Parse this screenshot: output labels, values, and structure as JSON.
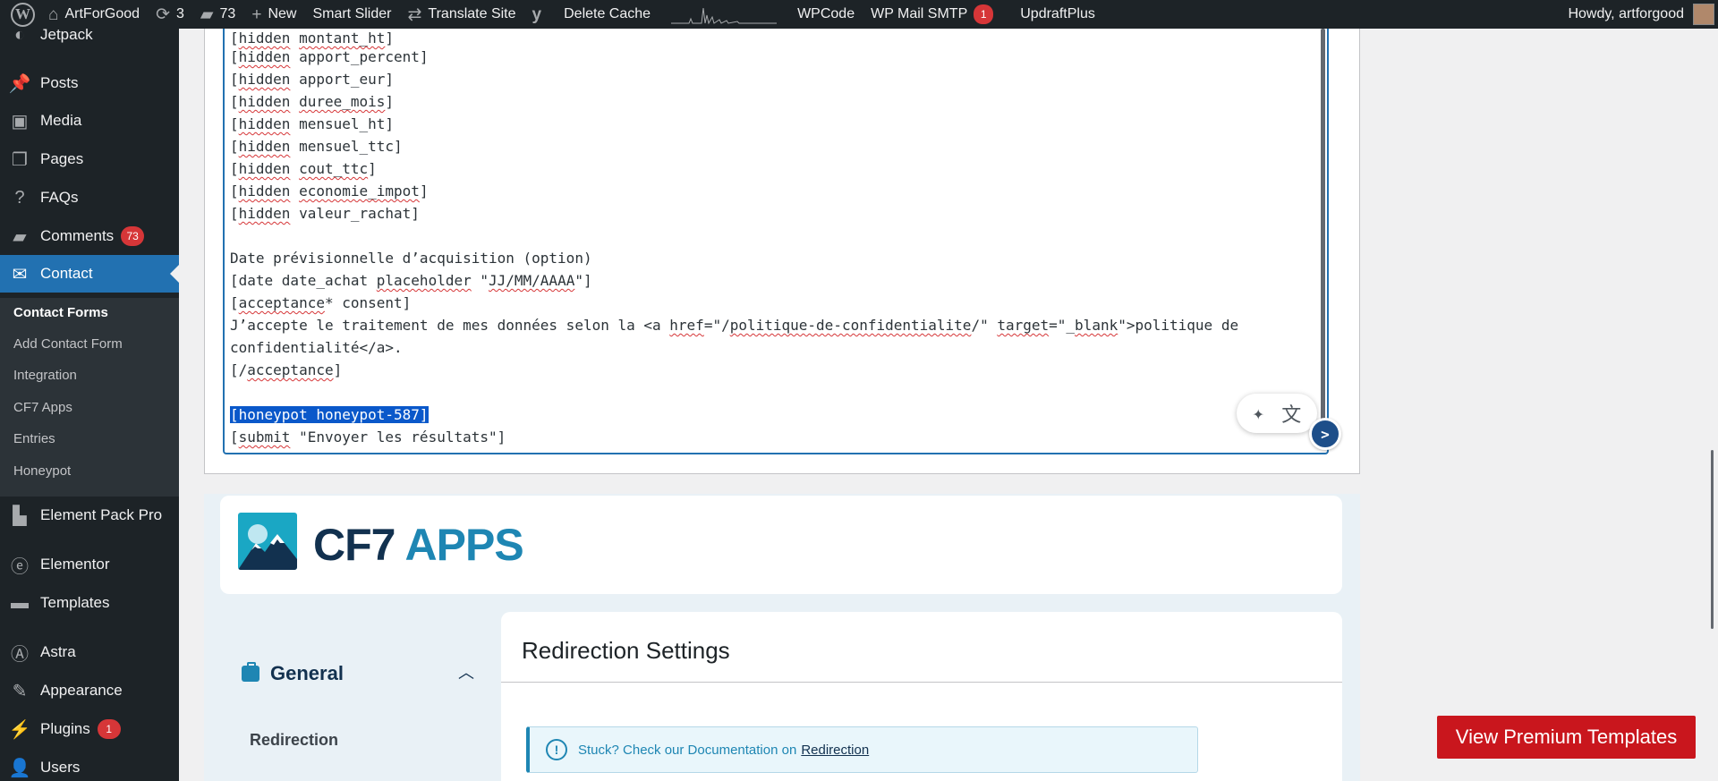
{
  "admin_bar": {
    "site_name": "ArtForGood",
    "updates_count": "3",
    "comments_count": "73",
    "new_label": "New",
    "smart_slider": "Smart Slider",
    "translate_site": "Translate Site",
    "delete_cache": "Delete Cache",
    "wpcode": "WPCode",
    "wp_mail_smtp": "WP Mail SMTP",
    "wp_mail_smtp_badge": "1",
    "updraftplus": "UpdraftPlus",
    "howdy": "Howdy, artforgood"
  },
  "sidebar": {
    "items": [
      {
        "label": "Jetpack"
      },
      {
        "label": "Posts"
      },
      {
        "label": "Media"
      },
      {
        "label": "Pages"
      },
      {
        "label": "FAQs"
      },
      {
        "label": "Comments",
        "badge": "73"
      },
      {
        "label": "Contact"
      },
      {
        "label": "Element Pack Pro"
      },
      {
        "label": "Elementor"
      },
      {
        "label": "Templates"
      },
      {
        "label": "Astra"
      },
      {
        "label": "Appearance"
      },
      {
        "label": "Plugins",
        "badge": "1"
      },
      {
        "label": "Users"
      }
    ],
    "submenu": [
      "Contact Forms",
      "Add Contact Form",
      "Integration",
      "CF7 Apps",
      "Entries",
      "Honeypot"
    ]
  },
  "editor": {
    "lines": [
      {
        "p": "[",
        "k": "hidden",
        "m": " ",
        "n": "montant_ht",
        "e": "]"
      },
      {
        "p": "[",
        "k": "hidden",
        "m": " apport_percent",
        "n": "",
        "e": "]"
      },
      {
        "p": "[",
        "k": "hidden",
        "m": " apport_eur",
        "n": "",
        "e": "]"
      },
      {
        "p": "[",
        "k": "hidden",
        "m": " ",
        "n": "duree_mois",
        "e": "]"
      },
      {
        "p": "[",
        "k": "hidden",
        "m": " mensuel_ht",
        "n": "",
        "e": "]"
      },
      {
        "p": "[",
        "k": "hidden",
        "m": " mensuel_ttc",
        "n": "",
        "e": "]"
      },
      {
        "p": "[",
        "k": "hidden",
        "m": " ",
        "n": "cout_ttc",
        "e": "]"
      },
      {
        "p": "[",
        "k": "hidden",
        "m": " ",
        "n": "economie_impot",
        "e": "]"
      },
      {
        "p": "[",
        "k": "hidden",
        "m": " valeur_rachat",
        "n": "",
        "e": "]"
      }
    ],
    "date_label": "Date prévisionnelle d’acquisition (option)",
    "date_tag_a": "[date date_achat ",
    "date_tag_b": "placeholder",
    "date_tag_c": " \"",
    "date_tag_d": "JJ/MM/AAAA",
    "date_tag_e": "\"]",
    "acc_a": "[",
    "acc_b": "acceptance",
    "acc_c": "* consent]",
    "acc_text_a": "J’accepte le traitement de mes données selon la <a ",
    "acc_text_b": "href",
    "acc_text_c": "=\"/",
    "acc_text_d": "politique-de-confidentialite",
    "acc_text_e": "/\" ",
    "acc_text_f": "target",
    "acc_text_g": "=\"_",
    "acc_text_h": "blank",
    "acc_text_i": "\">politique de",
    "acc_text2": "confidentialité</a>.",
    "acc_close_a": "[/",
    "acc_close_b": "acceptance",
    "acc_close_c": "]",
    "honeypot": "[honeypot honeypot-587]",
    "submit_a": "[",
    "submit_b": "submit",
    "submit_c": " \"Envoyer les résultats\"]"
  },
  "cf7_apps": {
    "logo_a": "CF7",
    "logo_b": "APPS",
    "section": "General",
    "nav_link": "Redirection",
    "card_title": "Redirection Settings",
    "notice_text": "Stuck? Check our Documentation on",
    "notice_link": "Redirection"
  },
  "premium_button": "View Premium Templates",
  "colors": {
    "admin_bg": "#1d2327",
    "active": "#2271b1",
    "badge": "#d63638",
    "premium": "#c9161d",
    "cf7_blue": "#1e86b3"
  }
}
